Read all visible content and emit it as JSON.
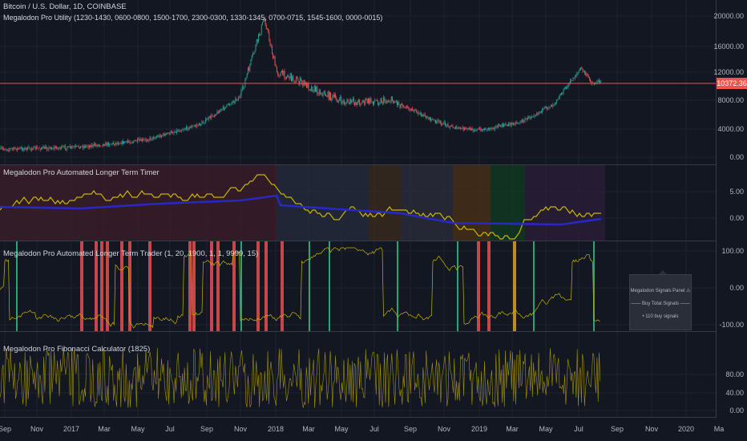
{
  "header": {
    "symbol": "Bitcoin / U.S. Dollar, 1D, COINBASE",
    "utility": "Megalodon Pro Utility (1230-1430, 0600-0800, 1500-1700, 2300-0300, 1330-1345, 0700-0715, 1545-1600, 0000-0015)"
  },
  "price_axis": [
    "20000.00",
    "16000.00",
    "12000.00",
    "8000.00",
    "4000.00",
    "0.00"
  ],
  "current_price": "10372.36",
  "panes": {
    "timer": {
      "title": "Megalodon Pro Automated Longer Term Timer",
      "axis": [
        "5.00",
        "0.00"
      ]
    },
    "trader": {
      "title": "Megalodon Pro Automated Longer Term Trader (1, 20, 1900, 1, 1, 9999, 15)",
      "axis": [
        "100.00",
        "0.00",
        "-100.00"
      ]
    },
    "fib": {
      "title": "Megalodon Pro Fibonacci Calculator (1825)",
      "axis": [
        "80.00",
        "40.00",
        "0.00"
      ]
    }
  },
  "signals_panel": {
    "title": "Megalodon Signals Panel ⚠",
    "heading": "—— Buy Total Signals ——",
    "count": "• 110 buy signals"
  },
  "time_axis": [
    "Sep",
    "Nov",
    "2017",
    "Mar",
    "May",
    "Jul",
    "Sep",
    "Nov",
    "2018",
    "Mar",
    "May",
    "Jul",
    "Sep",
    "Nov",
    "2019",
    "Mar",
    "May",
    "Jul",
    "Sep",
    "Nov",
    "2020",
    "Ma"
  ],
  "colors": {
    "up": "#26a69a",
    "down": "#ef5350",
    "price_line": "#f05350",
    "yellow": "#c8b400",
    "blue": "#2828c8"
  }
}
